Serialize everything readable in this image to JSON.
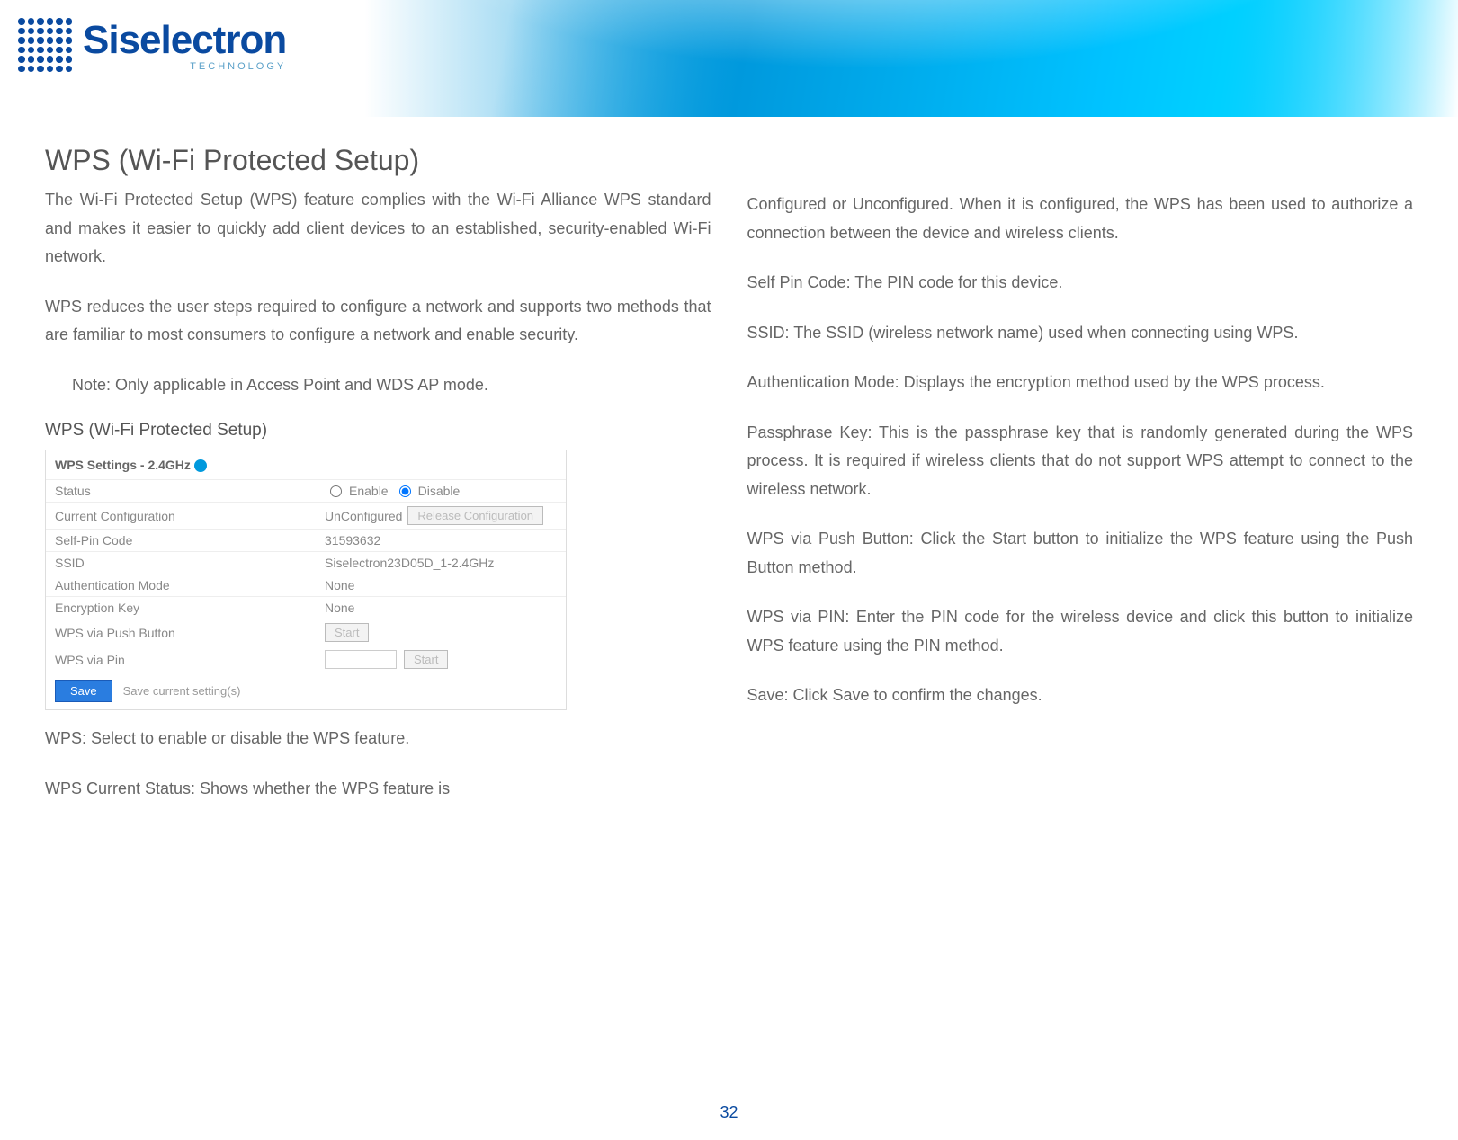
{
  "brand": {
    "name": "Siselectron",
    "sub": "TECHNOLOGY"
  },
  "page": {
    "title": "WPS (Wi-Fi Protected Setup)",
    "number": "32"
  },
  "left": {
    "p1": "The Wi-Fi Protected Setup (WPS) feature complies with the Wi-Fi Alliance WPS standard and makes it easier to quickly add client devices to an established, security-enabled Wi-Fi network.",
    "p2": "WPS reduces the user steps required to configure a network and supports two methods that are familiar to most consumers to configure a network and enable security.",
    "note": "Note: Only applicable in Access Point and WDS AP mode.",
    "subhead": "WPS (Wi-Fi Protected Setup)",
    "below1": "WPS: Select to enable or disable the WPS feature.",
    "below2": "WPS Current Status: Shows whether the WPS feature is"
  },
  "right": {
    "p1": "Configured or Unconfigured. When it is configured, the WPS has been used to authorize a connection between the device and wireless clients.",
    "p2": "Self Pin Code: The PIN code for this device.",
    "p3": "SSID: The SSID (wireless network name) used when connecting using WPS.",
    "p4": "Authentication Mode: Displays the encryption method used by the WPS process.",
    "p5": "Passphrase Key: This is the passphrase key that is randomly generated during the WPS process. It is required if wireless clients that do not support WPS attempt to connect to the wireless network.",
    "p6": "WPS via Push Button: Click the Start button to initialize the WPS feature using the Push Button method.",
    "p7": "WPS via PIN: Enter the PIN code for the wireless device and click this button to initialize WPS feature using the PIN method.",
    "p8": "Save: Click Save to confirm the changes."
  },
  "panel": {
    "title": "WPS Settings - 2.4GHz",
    "rows": {
      "status": {
        "label": "Status",
        "enable": "Enable",
        "disable": "Disable"
      },
      "current": {
        "label": "Current Configuration",
        "value": "UnConfigured",
        "button": "Release Configuration"
      },
      "selfpin": {
        "label": "Self-Pin Code",
        "value": "31593632"
      },
      "ssid": {
        "label": "SSID",
        "value": "Siselectron23D05D_1-2.4GHz"
      },
      "auth": {
        "label": "Authentication Mode",
        "value": "None"
      },
      "enc": {
        "label": "Encryption Key",
        "value": "None"
      },
      "push": {
        "label": "WPS via Push Button",
        "button": "Start"
      },
      "pin": {
        "label": "WPS via Pin",
        "button": "Start"
      }
    },
    "save": "Save",
    "save_hint": "Save current setting(s)"
  }
}
